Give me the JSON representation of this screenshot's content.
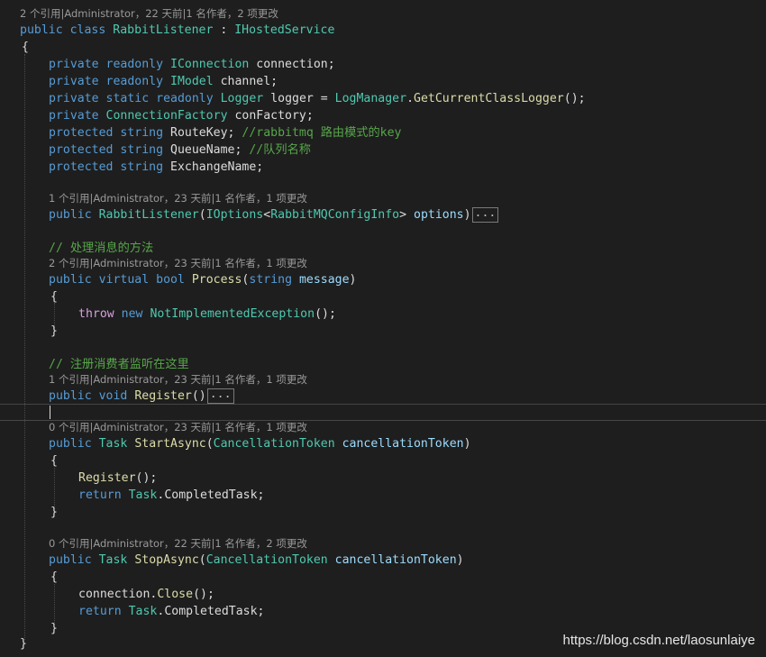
{
  "lens": {
    "class": "2 个引用|Administrator，22 天前|1 名作者，2 项更改",
    "ctor": "1 个引用|Administrator，23 天前|1 名作者，1 项更改",
    "process": "2 个引用|Administrator，23 天前|1 名作者，1 项更改",
    "register": "1 个引用|Administrator，23 天前|1 名作者，1 项更改",
    "start": "0 个引用|Administrator，23 天前|1 名作者，1 项更改",
    "stop": "0 个引用|Administrator，22 天前|1 名作者，2 项更改"
  },
  "code": {
    "kw_public": "public",
    "kw_class": "class",
    "kw_private": "private",
    "kw_readonly": "readonly",
    "kw_static": "static",
    "kw_protected": "protected",
    "kw_string": "string",
    "kw_virtual": "virtual",
    "kw_bool": "bool",
    "kw_throw": "throw",
    "kw_new": "new",
    "kw_void": "void",
    "kw_return": "return",
    "class_name": "RabbitListener",
    "class_colon": " : ",
    "iface": "IHostedService",
    "open_brace": "{",
    "close_brace": "}",
    "t_iconnection": "IConnection",
    "f_connection": " connection;",
    "t_imodel": "IModel",
    "f_channel": " channel;",
    "t_logger": "Logger",
    "f_logger_eq": " logger = ",
    "t_logmanager": "LogManager",
    "dot": ".",
    "m_getlogger": "GetCurrentClassLogger",
    "call_end": "();",
    "t_connfactory": "ConnectionFactory",
    "f_confactory": " conFactory;",
    "f_routekey": " RouteKey; ",
    "c_routekey": "//rabbitmq 路由模式的key",
    "f_queuename": " QueueName; ",
    "c_queuename": "//队列名称",
    "f_exchangename": " ExchangeName;",
    "ctor_name": "RabbitListener",
    "paren_open": "(",
    "t_ioptions": "IOptions",
    "lt": "<",
    "t_config": "RabbitMQConfigInfo",
    "gt": "> ",
    "p_options": "options",
    "paren_close": ")",
    "ellipsis": "...",
    "c_process": "// 处理消息的方法",
    "m_process": "Process",
    "p_message": " message",
    "t_notimpl": "NotImplementedException",
    "c_register": "// 注册消费者监听在这里",
    "m_register": "Register",
    "empty_parens": "()",
    "t_task": "Task",
    "m_startasync": "StartAsync",
    "t_ct": "CancellationToken",
    "p_ct": " cancellationToken",
    "m_register_call": "Register",
    "m_completedtask": "CompletedTask",
    "semi": ";",
    "m_stopasync": "StopAsync",
    "v_connection": "connection",
    "m_close": "Close"
  },
  "watermark": "https://blog.csdn.net/laosunlaiye"
}
